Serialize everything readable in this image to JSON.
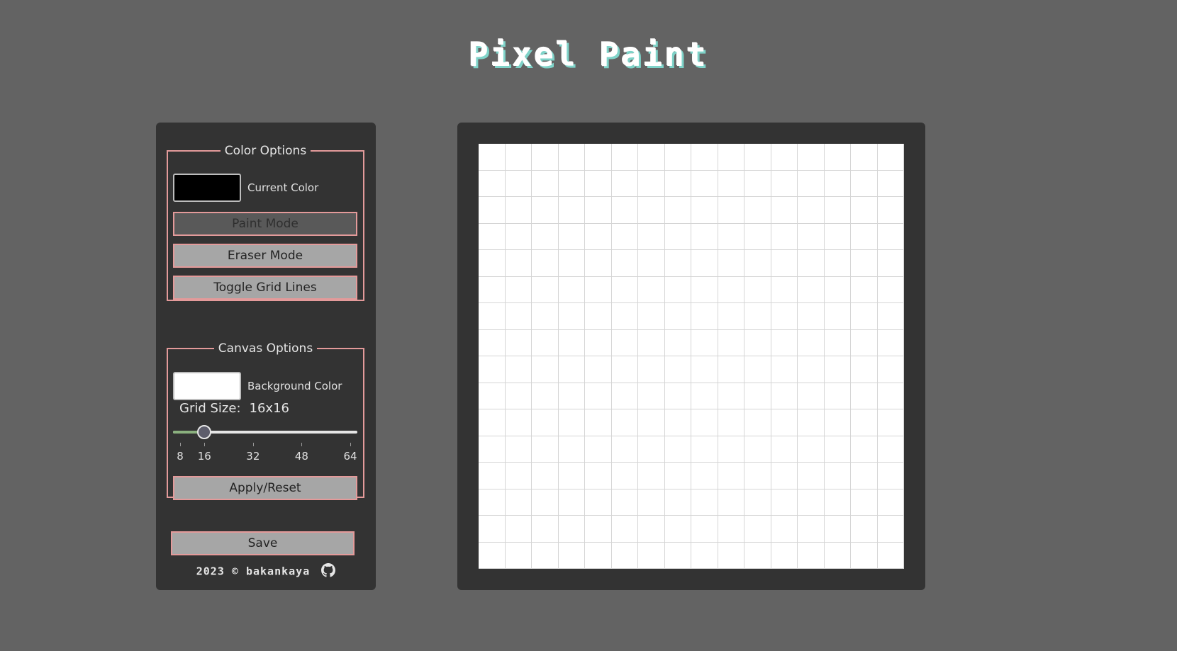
{
  "app": {
    "title": "Pixel Paint"
  },
  "color_options": {
    "legend": "Color Options",
    "current_color_label": "Current Color",
    "current_color": "#000000",
    "paint_mode_label": "Paint Mode",
    "eraser_mode_label": "Eraser Mode",
    "toggle_grid_label": "Toggle Grid Lines"
  },
  "canvas_options": {
    "legend": "Canvas Options",
    "background_color_label": "Background Color",
    "background_color": "#ffffff",
    "grid_size_label": "Grid Size:",
    "grid_size_value": "16x16",
    "slider": {
      "min": 8,
      "max": 64,
      "value": 16,
      "ticks": [
        "8",
        "16",
        "32",
        "48",
        "64"
      ]
    },
    "apply_label": "Apply/Reset"
  },
  "save_label": "Save",
  "footer": {
    "text": "2023 © bakankaya",
    "icon": "github-icon"
  },
  "grid": {
    "columns": 16,
    "rows": 16
  },
  "colors": {
    "accent": "#e39a9a",
    "panel": "#333333",
    "background": "#636363",
    "slider_fill": "#8ab07e"
  }
}
